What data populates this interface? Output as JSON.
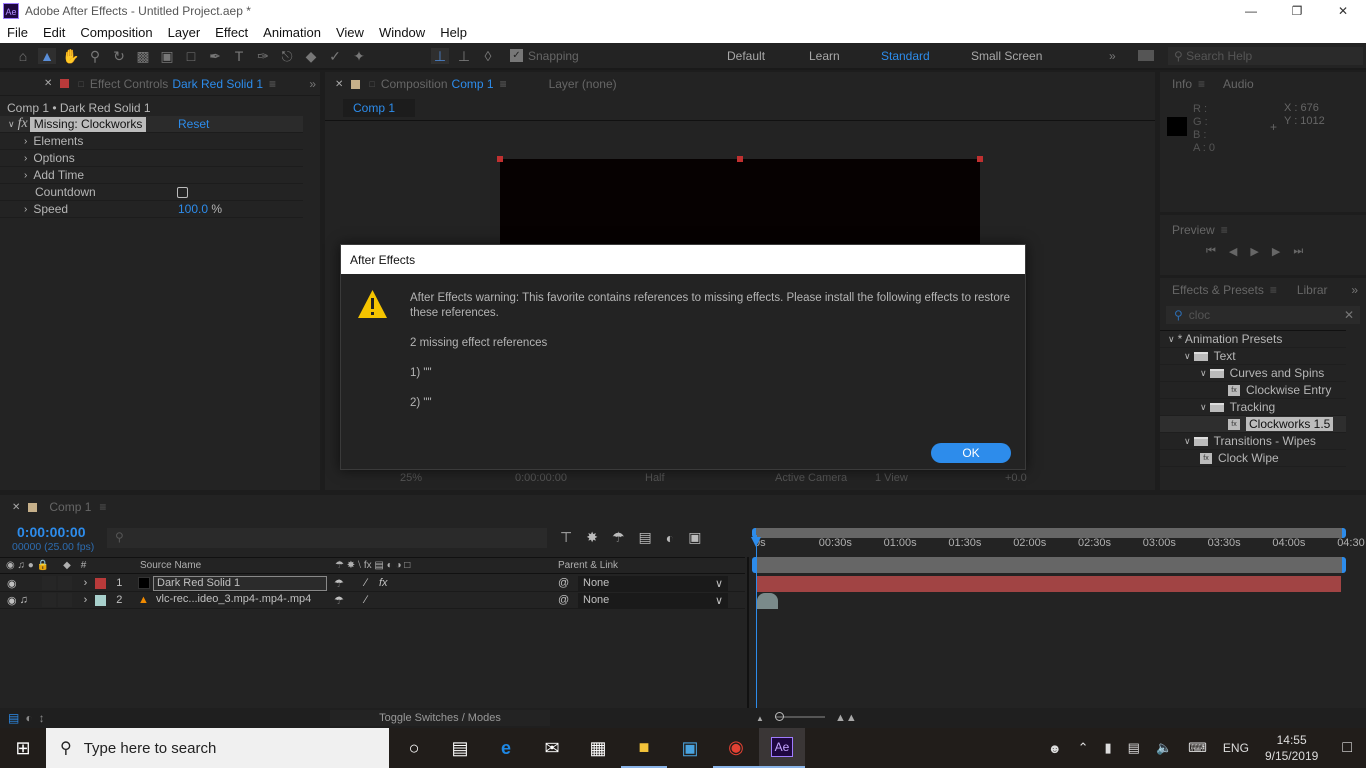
{
  "window": {
    "title": "Adobe After Effects - Untitled Project.aep *",
    "app_icon": "Ae",
    "controls": [
      "minimize-icon",
      "restore-icon",
      "close-icon"
    ]
  },
  "menu": [
    "File",
    "Edit",
    "Composition",
    "Layer",
    "Effect",
    "Animation",
    "View",
    "Window",
    "Help"
  ],
  "toolbar": {
    "snapping": "Snapping",
    "workspaces": [
      "Default",
      "Learn",
      "Standard",
      "Small Screen"
    ],
    "active_workspace": "Standard",
    "search_placeholder": "Search Help"
  },
  "effect_controls": {
    "tab_prefix": "Effect Controls",
    "tab_layer": "Dark Red Solid 1",
    "breadcrumb": "Comp 1 • Dark Red Solid 1",
    "effect_name": "Missing: Clockworks",
    "reset": "Reset",
    "props": [
      {
        "name": "Elements",
        "expand": true
      },
      {
        "name": "Options",
        "expand": true
      },
      {
        "name": "Add Time",
        "expand": true
      },
      {
        "name": "Countdown",
        "checkbox": false
      },
      {
        "name": "Speed",
        "expand": true,
        "value": "100.0",
        "unit": "%"
      }
    ]
  },
  "composition": {
    "tab_prefix": "Composition",
    "tab_comp": "Comp 1",
    "layer_tab": "Layer (none)",
    "subtab": "Comp 1",
    "footer": {
      "zoom": "25%",
      "time": "0:00:00:00",
      "resolution": "Half",
      "camera": "Active Camera",
      "views": "1 View",
      "exposure": "+0.0"
    }
  },
  "info": {
    "tab": "Info",
    "tab2": "Audio",
    "r": "R :",
    "g": "G :",
    "b": "B :",
    "a": "A : 0",
    "x": "X : 676",
    "y": "Y : 1012"
  },
  "preview": {
    "tab": "Preview"
  },
  "effects_presets": {
    "tab": "Effects & Presets",
    "tab2": "Librar",
    "search": "cloc",
    "tree": [
      {
        "label": "* Animation Presets",
        "level": 0,
        "type": "root"
      },
      {
        "label": "Text",
        "level": 1,
        "type": "folder"
      },
      {
        "label": "Curves and Spins",
        "level": 2,
        "type": "folder"
      },
      {
        "label": "Clockwise Entry",
        "level": 3,
        "type": "preset"
      },
      {
        "label": "Tracking",
        "level": 2,
        "type": "folder"
      },
      {
        "label": "Clockworks 1.5",
        "level": 3,
        "type": "preset",
        "selected": true
      },
      {
        "label": "Transitions - Wipes",
        "level": 1,
        "type": "folder"
      },
      {
        "label": "Clock Wipe",
        "level": 2,
        "type": "preset"
      }
    ]
  },
  "dialog": {
    "title": "After Effects",
    "message": "After Effects warning: This favorite contains references to missing effects. Please install the following effects to restore these references.",
    "count": "2 missing effect references",
    "items": [
      "1)   \"\"",
      "2)   \"\""
    ],
    "ok": "OK"
  },
  "timeline": {
    "tab": "Comp 1",
    "timecode": "0:00:00:00",
    "frames": "00000 (25.00 fps)",
    "col_source": "Source Name",
    "col_num": "#",
    "col_parent": "Parent & Link",
    "layers": [
      {
        "num": "1",
        "name": "Dark Red Solid 1",
        "label_color": "#b83a3a",
        "parent": "None"
      },
      {
        "num": "2",
        "name": "vlc-rec...ideo_3.mp4-.mp4-.mp4",
        "label_color": "#a8d0cc",
        "parent": "None"
      }
    ],
    "ruler": [
      "0s",
      "00:30s",
      "01:00s",
      "01:30s",
      "02:00s",
      "02:30s",
      "03:00s",
      "03:30s",
      "04:00s",
      "04:30"
    ],
    "toggle": "Toggle Switches / Modes"
  },
  "taskbar": {
    "search": "Type here to search",
    "lang": "ENG",
    "time": "14:55",
    "date": "9/15/2019"
  },
  "colors": {
    "accent": "#2d8ceb",
    "solid_bar": "#a14444",
    "warning": "#f5c400"
  }
}
